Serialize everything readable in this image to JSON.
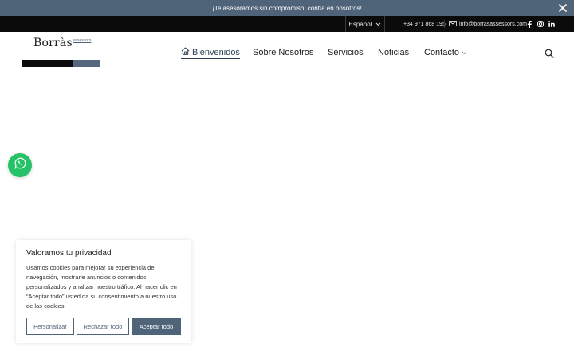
{
  "announcement": {
    "text": "¡Te asesoramos sin compromiso, confía en nosotros!"
  },
  "topbar": {
    "language": "Español",
    "phone": "+34 971 868 195",
    "email": "info@borrasassessors.com"
  },
  "logo": {
    "name": "Borràs",
    "sub": "assessors"
  },
  "nav": {
    "items": [
      {
        "label": "Bienvenidos"
      },
      {
        "label": "Sobre Nosotros"
      },
      {
        "label": "Servicios"
      },
      {
        "label": "Noticias"
      },
      {
        "label": "Contacto"
      }
    ]
  },
  "cookie": {
    "title": "Valoramos tu privacidad",
    "text": "Usamos cookies para mejorar su experiencia de navegación, mostrarle anuncios o contenidos personalizados y analizar nuestro tráfico. Al hacer clic en “Aceptar todo” usted da su consentimiento a nuestro uso de las cookies.",
    "customize": "Personalizar",
    "reject": "Rechazar todo",
    "accept": "Aceptar todo"
  },
  "colors": {
    "accent": "#4f6379",
    "topbar": "#0b0b0b",
    "whatsapp": "#25c267"
  },
  "icons": [
    "close-icon",
    "chevron-down-icon",
    "mail-icon",
    "facebook-icon",
    "instagram-icon",
    "linkedin-icon",
    "home-icon",
    "search-icon",
    "whatsapp-icon"
  ]
}
